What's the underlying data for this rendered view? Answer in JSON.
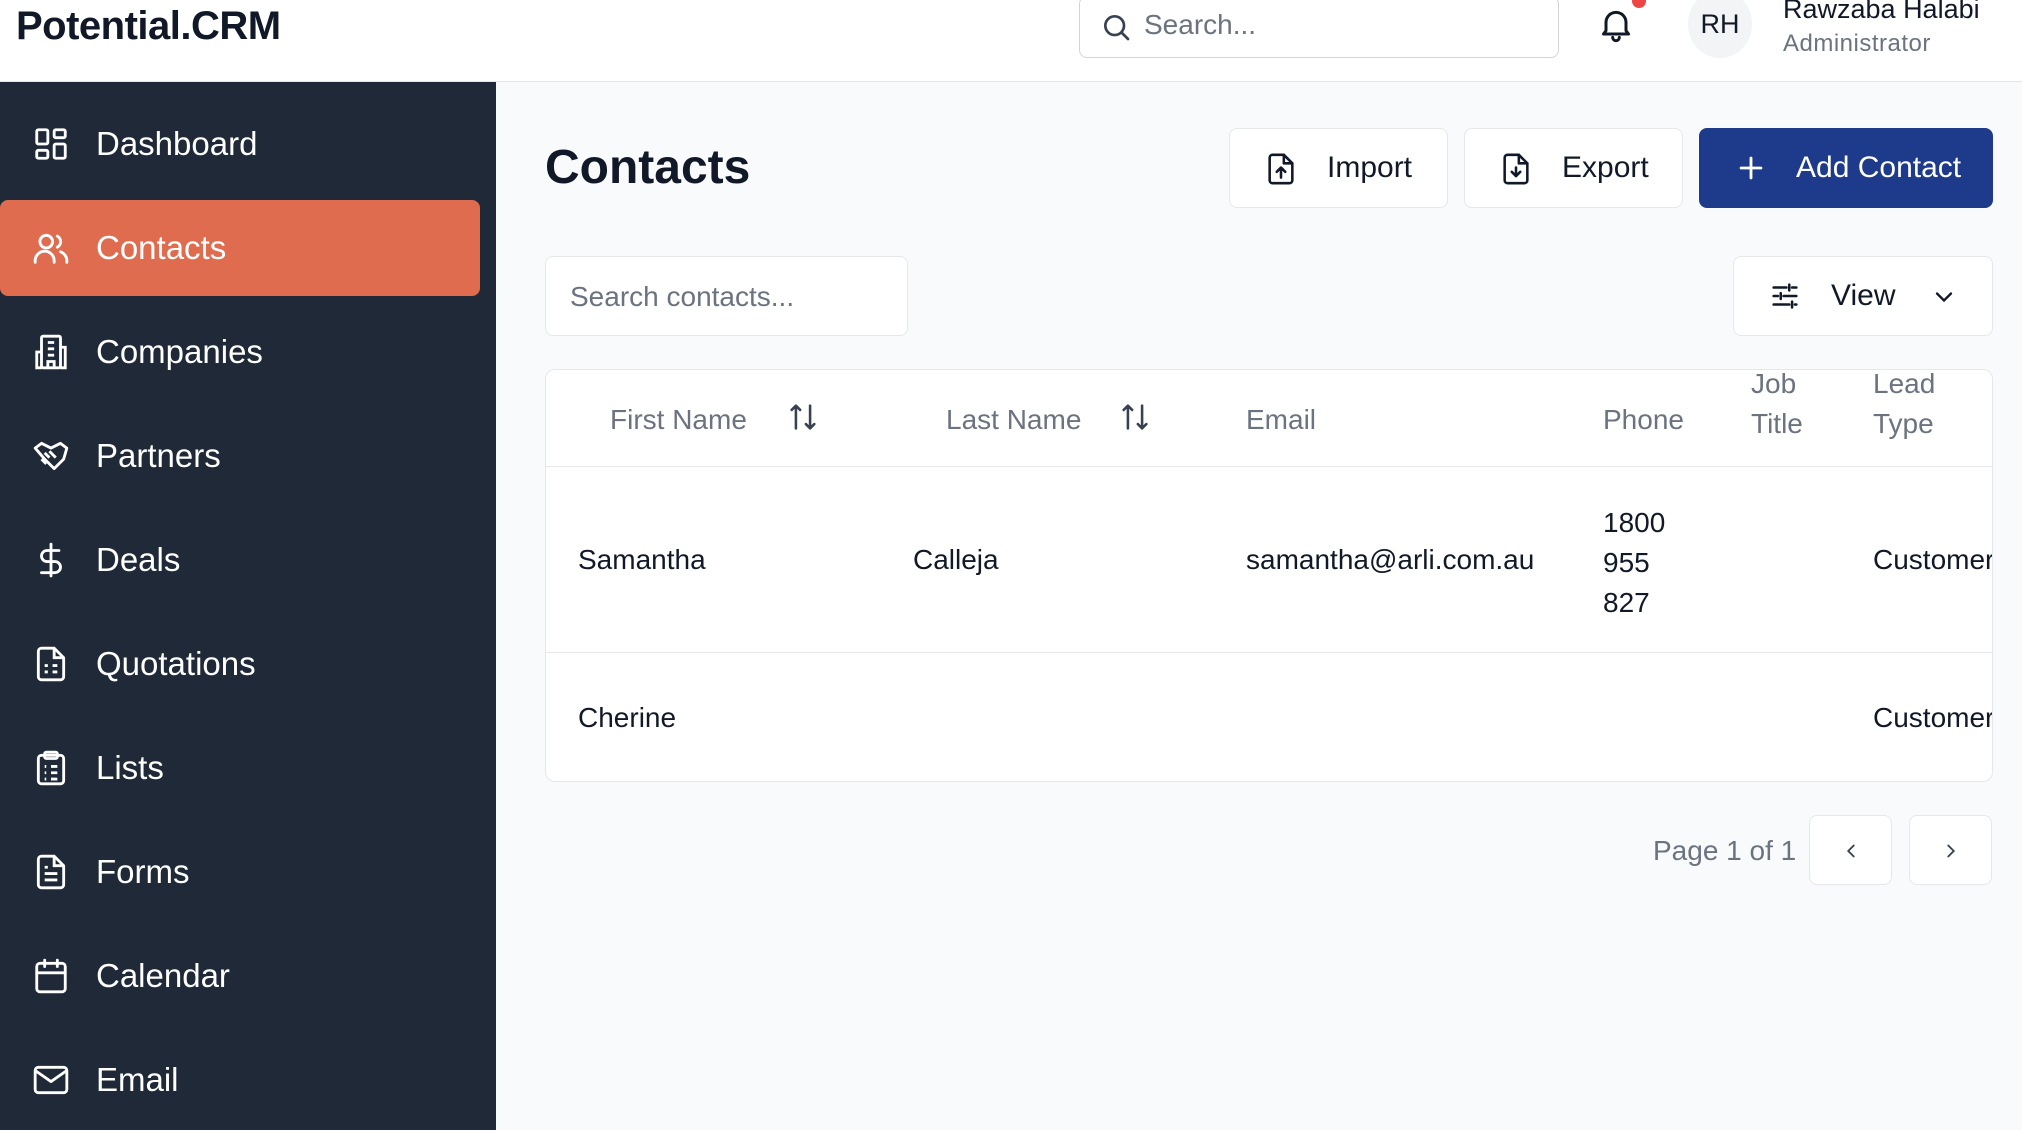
{
  "app": {
    "logo": "Potential.CRM"
  },
  "header": {
    "search_placeholder": "Search...",
    "user": {
      "initials": "RH",
      "name": "Rawzaba Halabi",
      "role": "Administrator"
    }
  },
  "sidebar": {
    "items": [
      {
        "label": "Dashboard",
        "icon": "dashboard-icon",
        "active": false
      },
      {
        "label": "Contacts",
        "icon": "users-icon",
        "active": true
      },
      {
        "label": "Companies",
        "icon": "building-icon",
        "active": false
      },
      {
        "label": "Partners",
        "icon": "handshake-icon",
        "active": false
      },
      {
        "label": "Deals",
        "icon": "dollar-icon",
        "active": false
      },
      {
        "label": "Quotations",
        "icon": "quote-doc-icon",
        "active": false
      },
      {
        "label": "Lists",
        "icon": "clipboard-list-icon",
        "active": false
      },
      {
        "label": "Forms",
        "icon": "form-doc-icon",
        "active": false
      },
      {
        "label": "Calendar",
        "icon": "calendar-icon",
        "active": false
      },
      {
        "label": "Email",
        "icon": "mail-icon",
        "active": false
      }
    ]
  },
  "main": {
    "title": "Contacts",
    "actions": {
      "import": "Import",
      "export": "Export",
      "add": "Add Contact"
    },
    "search_placeholder": "Search contacts...",
    "view_label": "View",
    "table": {
      "columns": {
        "first_name": "First Name",
        "last_name": "Last Name",
        "email": "Email",
        "phone": "Phone",
        "job_title_1": "Job",
        "job_title_2": "Title",
        "lead_type_1": "Lead",
        "lead_type_2": "Type"
      },
      "rows": [
        {
          "first_name": "Samantha",
          "last_name": "Calleja",
          "email": "samantha@arli.com.au",
          "phone_1": "1800",
          "phone_2": "955",
          "phone_3": "827",
          "lead_type": "Customer"
        },
        {
          "first_name": "Cherine",
          "last_name": "",
          "email": "",
          "lead_type": "Customer"
        }
      ]
    },
    "pagination": {
      "text": "Page 1 of 1"
    }
  },
  "colors": {
    "sidebar_bg": "#1f2937",
    "active_item": "#e06c50",
    "primary_button": "#1e3a8a",
    "notification_dot": "#ef4444"
  }
}
